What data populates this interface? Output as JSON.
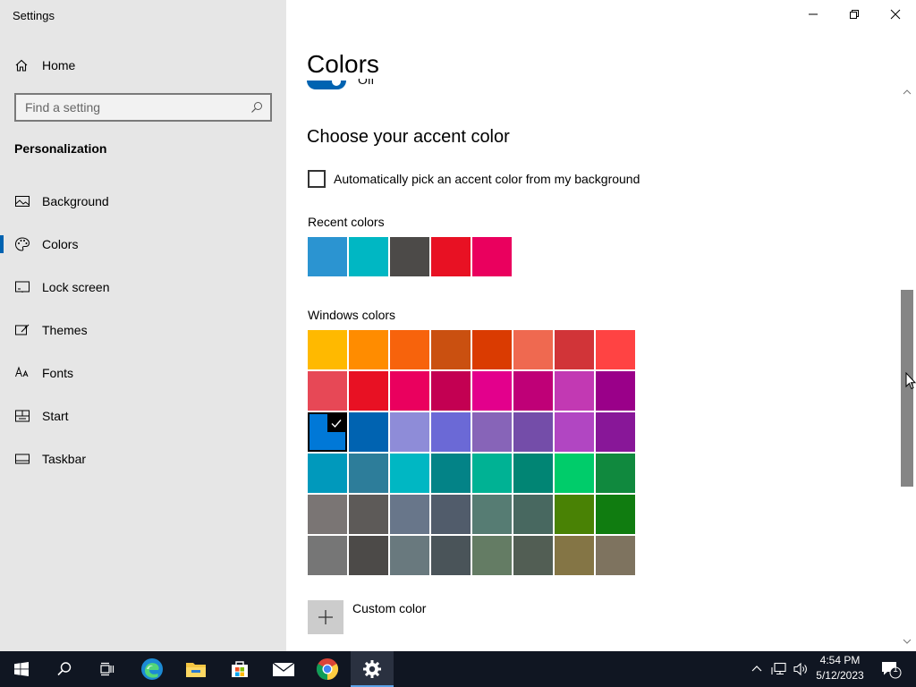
{
  "app": {
    "title": "Settings"
  },
  "sidebar": {
    "home_label": "Home",
    "search_placeholder": "Find a setting",
    "section_title": "Personalization",
    "items": [
      {
        "label": "Background",
        "icon": "picture-icon",
        "active": false
      },
      {
        "label": "Colors",
        "icon": "palette-icon",
        "active": true
      },
      {
        "label": "Lock screen",
        "icon": "lock-screen-icon",
        "active": false
      },
      {
        "label": "Themes",
        "icon": "themes-icon",
        "active": false
      },
      {
        "label": "Fonts",
        "icon": "fonts-icon",
        "active": false
      },
      {
        "label": "Start",
        "icon": "start-icon",
        "active": false
      },
      {
        "label": "Taskbar",
        "icon": "taskbar-icon",
        "active": false
      }
    ]
  },
  "content": {
    "page_title": "Colors",
    "toggle_peek_text": "Off",
    "accent_heading": "Choose your accent color",
    "auto_pick_label": "Automatically pick an accent color from my background",
    "auto_pick_checked": false,
    "recent_label": "Recent colors",
    "recent_colors": [
      "#2b94d1",
      "#00b7c3",
      "#4c4a48",
      "#e81123",
      "#ea005e"
    ],
    "windows_label": "Windows colors",
    "windows_colors": [
      [
        "#ffb900",
        "#ff8c00",
        "#f7630c",
        "#ca5010",
        "#da3b01",
        "#ef6950",
        "#d13438",
        "#ff4343"
      ],
      [
        "#e74856",
        "#e81123",
        "#ea005e",
        "#c30052",
        "#e3008c",
        "#bf0077",
        "#c239b3",
        "#9a0089"
      ],
      [
        "#0078d7",
        "#0063b1",
        "#8e8cd8",
        "#6b69d6",
        "#8764b8",
        "#744da9",
        "#b146c2",
        "#881798"
      ],
      [
        "#0099bc",
        "#2d7d9a",
        "#00b7c3",
        "#038387",
        "#00b294",
        "#018574",
        "#00cc6a",
        "#10893e"
      ],
      [
        "#7a7574",
        "#5d5a58",
        "#68768a",
        "#515c6b",
        "#567c73",
        "#486860",
        "#498205",
        "#107c10"
      ],
      [
        "#767676",
        "#4c4a48",
        "#69797e",
        "#4a5459",
        "#647c64",
        "#525e54",
        "#847545",
        "#7e735f"
      ]
    ],
    "selected_color": "#0078d7",
    "custom_color_label": "Custom color"
  },
  "taskbar": {
    "apps": [
      "windows-start-icon",
      "search-icon",
      "task-view-icon",
      "edge-icon",
      "file-explorer-icon",
      "store-icon",
      "mail-icon",
      "chrome-icon",
      "settings-gear-icon"
    ],
    "active_app": "settings-gear-icon",
    "time": "4:54 PM",
    "date": "5/12/2023",
    "notification_count": "1"
  }
}
